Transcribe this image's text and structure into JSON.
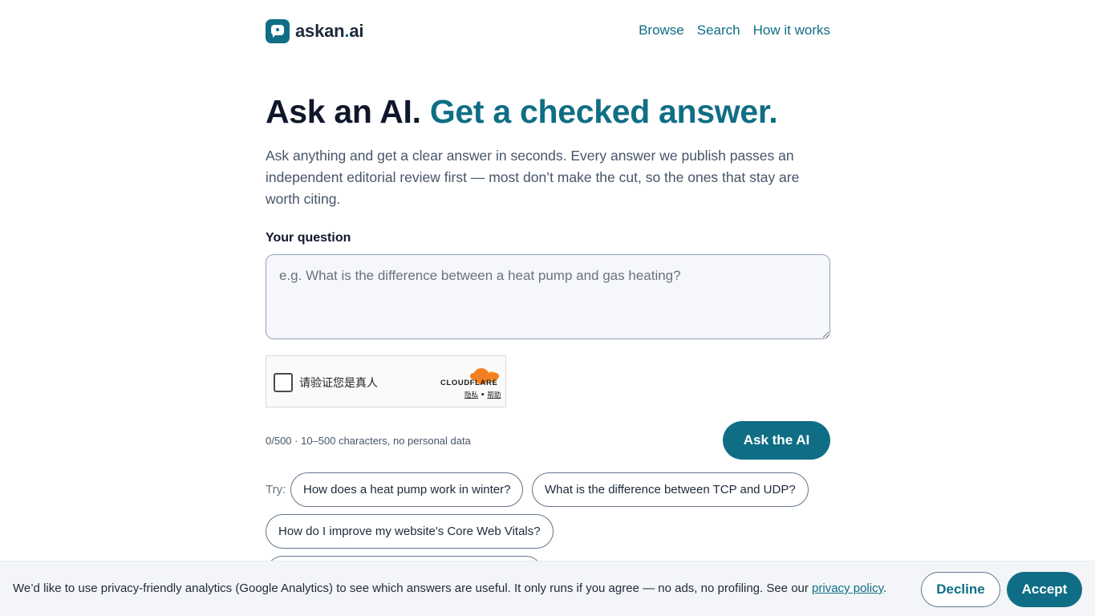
{
  "header": {
    "logo_text": "askan",
    "logo_dot": ".",
    "logo_tld": "ai",
    "nav": [
      "Browse",
      "Search",
      "How it works"
    ]
  },
  "hero": {
    "title_main": "Ask an AI.",
    "title_accent": "Get a checked answer.",
    "subtitle": "Ask anything and get a clear answer in seconds. Every answer we publish passes an independent editorial review first — most don’t make the cut, so the ones that stay are worth citing."
  },
  "form": {
    "label": "Your question",
    "placeholder": "e.g. What is the difference between a heat pump and gas heating?",
    "value": "",
    "counter": "0/500 · 10–500 characters, no personal data",
    "submit_label": "Ask the AI"
  },
  "captcha": {
    "label": "请验证您是真人",
    "brand": "CLOUDFLARE",
    "privacy": "隐私",
    "separator": " • ",
    "help": "帮助",
    "brand_color": "#f38020"
  },
  "suggestions": {
    "label": "Try:",
    "items": [
      "How does a heat pump work in winter?",
      "What is the difference between TCP and UDP?",
      "How do I improve my website's Core Web Vitals?",
      ""
    ]
  },
  "cookie_bar": {
    "text": "We’d like to use privacy-friendly analytics (Google Analytics) to see which answers are useful. It only runs if you agree — no ads, no profiling. See our ",
    "link": "privacy policy",
    "end": ".",
    "decline": "Decline",
    "accept": "Accept"
  },
  "colors": {
    "accent": "#0f6e85",
    "text": "#0f172a",
    "muted": "#475569"
  }
}
